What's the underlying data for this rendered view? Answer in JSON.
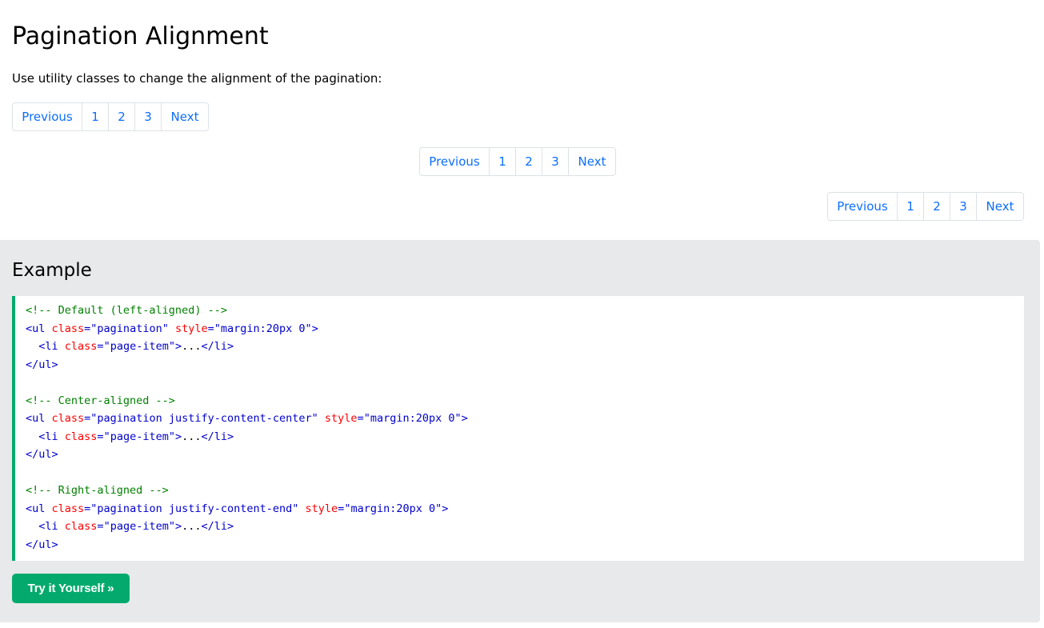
{
  "page": {
    "title": "Pagination Alignment",
    "intro": "Use utility classes to change the alignment of the pagination:"
  },
  "paginations": [
    {
      "id": "left",
      "items": [
        "Previous",
        "1",
        "2",
        "3",
        "Next"
      ]
    },
    {
      "id": "center",
      "items": [
        "Previous",
        "1",
        "2",
        "3",
        "Next"
      ]
    },
    {
      "id": "right",
      "items": [
        "Previous",
        "1",
        "2",
        "3",
        "Next"
      ]
    }
  ],
  "example": {
    "title": "Example",
    "code_lines": [
      [
        {
          "t": "comment",
          "v": "<!-- Default (left-aligned) -->"
        }
      ],
      [
        {
          "t": "tag",
          "v": "<ul "
        },
        {
          "t": "attr",
          "v": "class"
        },
        {
          "t": "tag",
          "v": "="
        },
        {
          "t": "val",
          "v": "\"pagination\""
        },
        {
          "t": "tag",
          "v": " "
        },
        {
          "t": "attr",
          "v": "style"
        },
        {
          "t": "tag",
          "v": "="
        },
        {
          "t": "val",
          "v": "\"margin:20px 0\""
        },
        {
          "t": "tag",
          "v": ">"
        }
      ],
      [
        {
          "t": "text",
          "v": "  "
        },
        {
          "t": "tag",
          "v": "<li "
        },
        {
          "t": "attr",
          "v": "class"
        },
        {
          "t": "tag",
          "v": "="
        },
        {
          "t": "val",
          "v": "\"page-item\""
        },
        {
          "t": "tag",
          "v": ">"
        },
        {
          "t": "text",
          "v": "..."
        },
        {
          "t": "tag",
          "v": "</li>"
        }
      ],
      [
        {
          "t": "tag",
          "v": "</ul>"
        }
      ],
      [
        {
          "t": "text",
          "v": ""
        }
      ],
      [
        {
          "t": "comment",
          "v": "<!-- Center-aligned -->"
        }
      ],
      [
        {
          "t": "tag",
          "v": "<ul "
        },
        {
          "t": "attr",
          "v": "class"
        },
        {
          "t": "tag",
          "v": "="
        },
        {
          "t": "val",
          "v": "\"pagination justify-content-center\""
        },
        {
          "t": "tag",
          "v": " "
        },
        {
          "t": "attr",
          "v": "style"
        },
        {
          "t": "tag",
          "v": "="
        },
        {
          "t": "val",
          "v": "\"margin:20px 0\""
        },
        {
          "t": "tag",
          "v": ">"
        }
      ],
      [
        {
          "t": "text",
          "v": "  "
        },
        {
          "t": "tag",
          "v": "<li "
        },
        {
          "t": "attr",
          "v": "class"
        },
        {
          "t": "tag",
          "v": "="
        },
        {
          "t": "val",
          "v": "\"page-item\""
        },
        {
          "t": "tag",
          "v": ">"
        },
        {
          "t": "text",
          "v": "..."
        },
        {
          "t": "tag",
          "v": "</li>"
        }
      ],
      [
        {
          "t": "tag",
          "v": "</ul>"
        }
      ],
      [
        {
          "t": "text",
          "v": ""
        }
      ],
      [
        {
          "t": "comment",
          "v": "<!-- Right-aligned -->"
        }
      ],
      [
        {
          "t": "tag",
          "v": "<ul "
        },
        {
          "t": "attr",
          "v": "class"
        },
        {
          "t": "tag",
          "v": "="
        },
        {
          "t": "val",
          "v": "\"pagination justify-content-end\""
        },
        {
          "t": "tag",
          "v": " "
        },
        {
          "t": "attr",
          "v": "style"
        },
        {
          "t": "tag",
          "v": "="
        },
        {
          "t": "val",
          "v": "\"margin:20px 0\""
        },
        {
          "t": "tag",
          "v": ">"
        }
      ],
      [
        {
          "t": "text",
          "v": "  "
        },
        {
          "t": "tag",
          "v": "<li "
        },
        {
          "t": "attr",
          "v": "class"
        },
        {
          "t": "tag",
          "v": "="
        },
        {
          "t": "val",
          "v": "\"page-item\""
        },
        {
          "t": "tag",
          "v": ">"
        },
        {
          "t": "text",
          "v": "..."
        },
        {
          "t": "tag",
          "v": "</li>"
        }
      ],
      [
        {
          "t": "tag",
          "v": "</ul>"
        }
      ]
    ],
    "try_button_label": "Try it Yourself »"
  },
  "colors": {
    "link": "#0d6efd",
    "accent": "#04aa6d",
    "panel_bg": "#e7e9eb",
    "comment": "#008000",
    "tag": "#0000cd",
    "attr": "#ff0000"
  }
}
